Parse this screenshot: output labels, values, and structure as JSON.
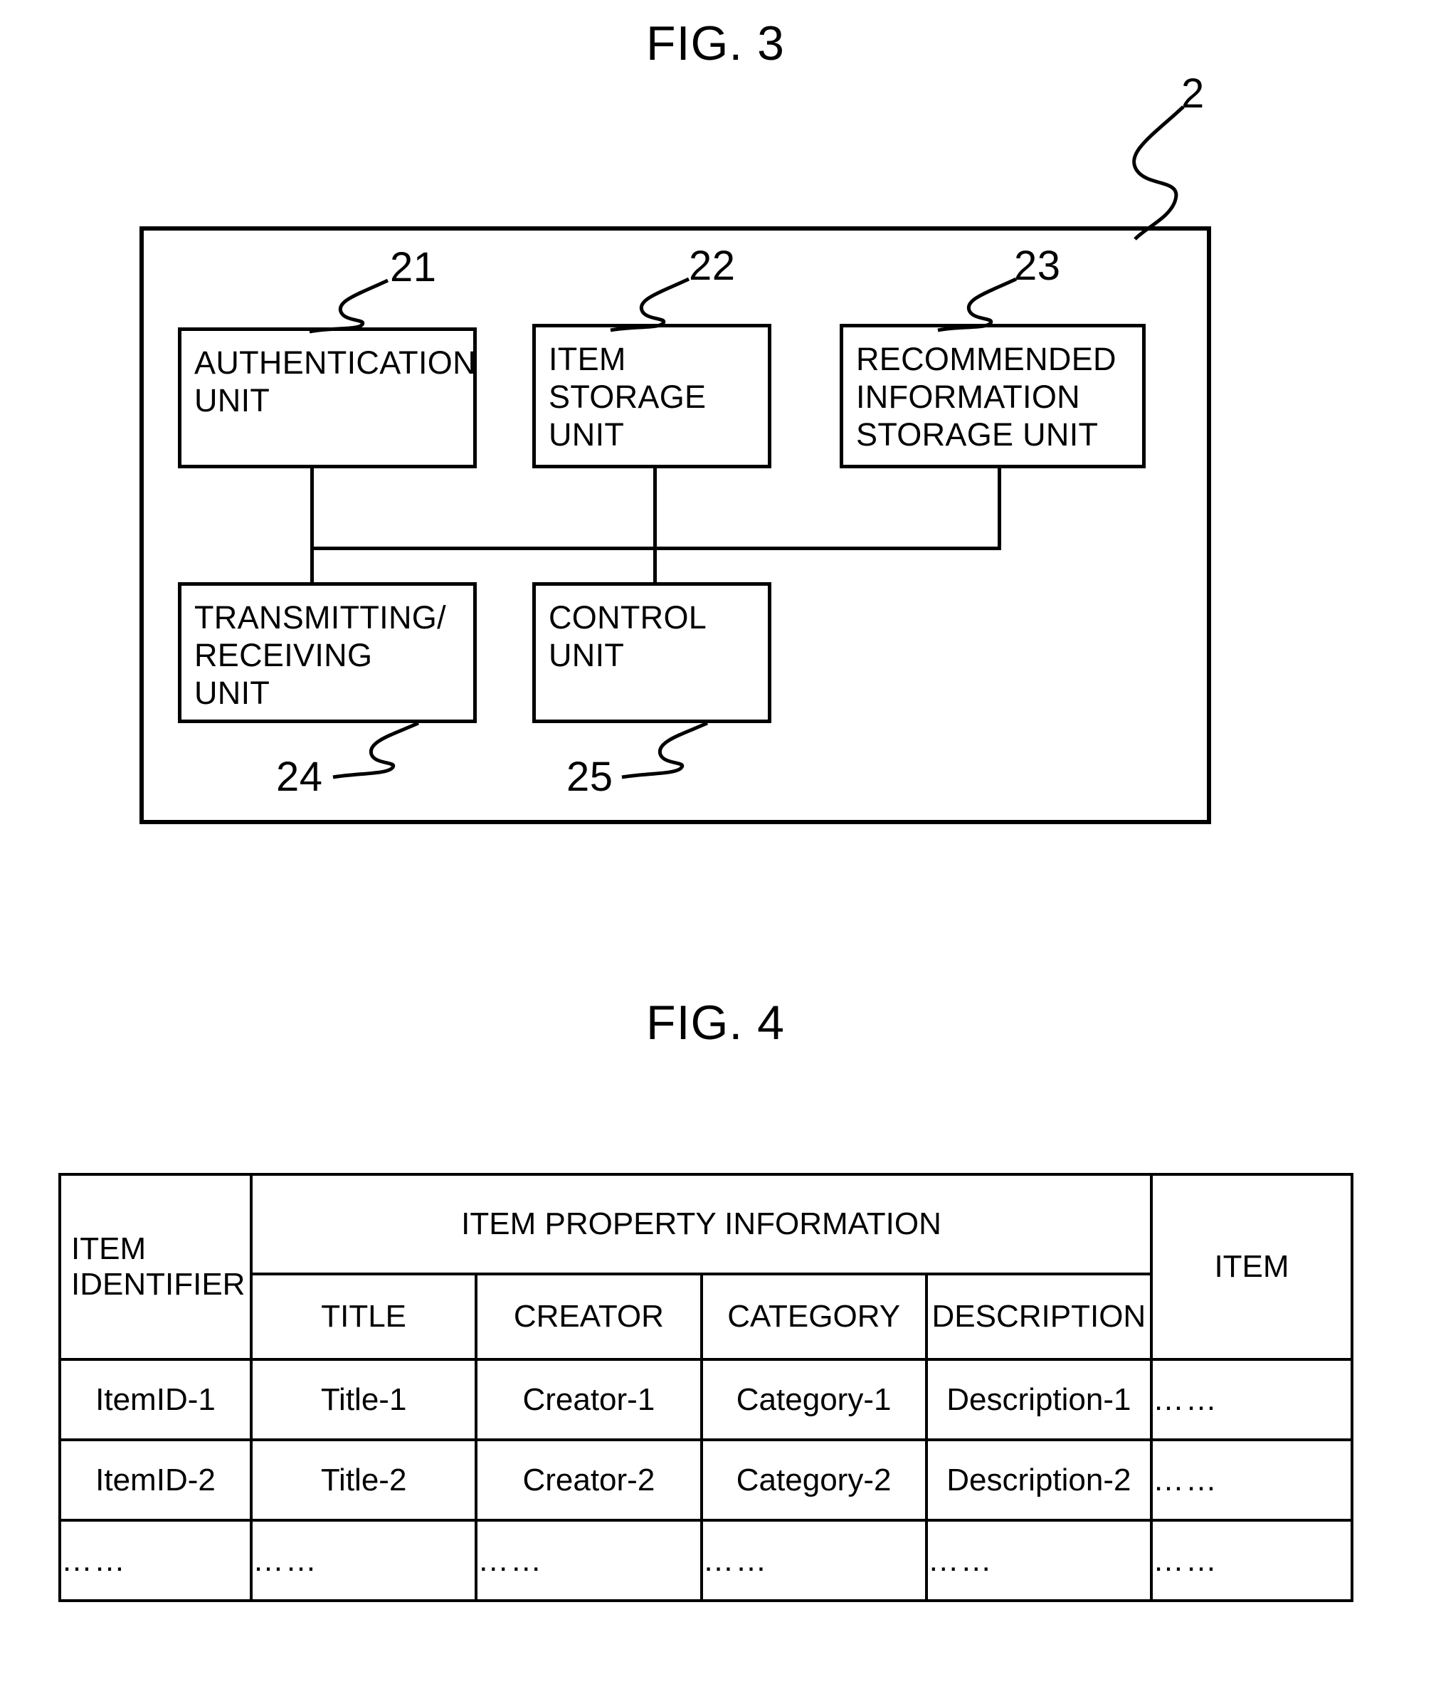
{
  "figures": {
    "fig3": {
      "title": "FIG. 3",
      "container_ref": "2",
      "blocks": [
        {
          "ref": "21",
          "lines": [
            "AUTHENTICATION",
            "UNIT"
          ],
          "label": "AUTHENTICATION UNIT"
        },
        {
          "ref": "22",
          "lines": [
            "ITEM",
            "STORAGE",
            "UNIT"
          ],
          "label": "ITEM STORAGE UNIT"
        },
        {
          "ref": "23",
          "lines": [
            "RECOMMENDED",
            "INFORMATION",
            "STORAGE  UNIT"
          ],
          "label": "RECOMMENDED INFORMATION STORAGE UNIT"
        },
        {
          "ref": "24",
          "lines": [
            "TRANSMITTING/",
            "RECEIVING",
            "UNIT"
          ],
          "label": "TRANSMITTING/RECEIVING UNIT"
        },
        {
          "ref": "25",
          "lines": [
            "CONTROL",
            "UNIT"
          ],
          "label": "CONTROL UNIT"
        }
      ]
    },
    "fig4": {
      "title": "FIG. 4",
      "table": {
        "header_row1": {
          "item_identifier": "ITEM\nIDENTIFIER",
          "item_identifier_line1": "ITEM",
          "item_identifier_line2": "IDENTIFIER",
          "item_property_information": "ITEM PROPERTY INFORMATION",
          "item": "ITEM"
        },
        "header_row2": [
          "TITLE",
          "CREATOR",
          "CATEGORY",
          "DESCRIPTION"
        ],
        "rows": [
          [
            "ItemID-1",
            "Title-1",
            "Creator-1",
            "Category-1",
            "Description-1",
            "……"
          ],
          [
            "ItemID-2",
            "Title-2",
            "Creator-2",
            "Category-2",
            "Description-2",
            "……"
          ],
          [
            "……",
            "……",
            "……",
            "……",
            "……",
            "……"
          ]
        ]
      }
    }
  },
  "colors": {
    "ink": "#000000",
    "paper": "#ffffff"
  }
}
